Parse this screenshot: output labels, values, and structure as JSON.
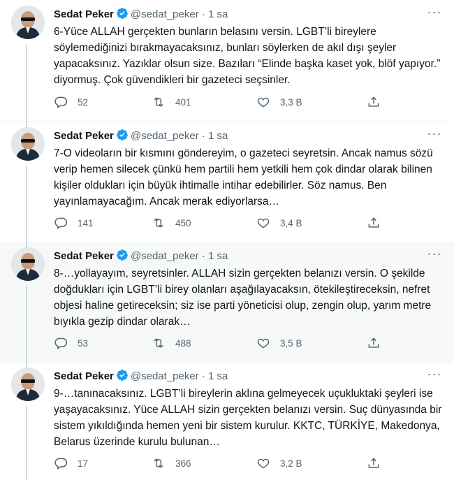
{
  "tweets": [
    {
      "author": "Sedat Peker",
      "handle": "@sedat_peker",
      "separator": "·",
      "time": "1 sa",
      "text": "6-Yüce ALLAH gerçekten bunların belasını versin. LGBT’li bireylere söylemediğinizi bırakmayacaksınız, bunları söylerken de akıl dışı şeyler yapacaksınız. Yazıklar olsun size. Bazıları “Elinde başka kaset yok, blöf yapıyor.” diyormuş. Çok güvendikleri bir gazeteci seçsinler.",
      "replies": "52",
      "retweets": "401",
      "likes": "3,3 B"
    },
    {
      "author": "Sedat Peker",
      "handle": "@sedat_peker",
      "separator": "·",
      "time": "1 sa",
      "text": "7-O videoların bir kısmını göndereyim, o gazeteci seyretsin. Ancak namus sözü verip hemen silecek çünkü hem partili hem yetkili hem çok dindar olarak bilinen kişiler oldukları için büyük ihtimalle intihar edebilirler. Söz namus. Ben yayınlamayacağım. Ancak merak ediyorlarsa…",
      "replies": "141",
      "retweets": "450",
      "likes": "3,4 B"
    },
    {
      "author": "Sedat Peker",
      "handle": "@sedat_peker",
      "separator": "·",
      "time": "1 sa",
      "text": "8-…yollayayım, seyretsinler. ALLAH sizin gerçekten belanızı versin. O şekilde doğdukları için LGBT’li birey olanları aşağılayacaksın, ötekileştireceksin, nefret objesi haline getireceksin; siz ise parti yöneticisi olup, zengin olup, yarım metre bıyıkla gezip dindar olarak…",
      "replies": "53",
      "retweets": "488",
      "likes": "3,5 B"
    },
    {
      "author": "Sedat Peker",
      "handle": "@sedat_peker",
      "separator": "·",
      "time": "1 sa",
      "text": "9-…tanınacaksınız. LGBT’li bireylerin aklına gelmeyecek uçukluktaki şeyleri ise yaşayacaksınız. Yüce ALLAH sizin gerçekten belanızı versin. Suç dünyasında bir sistem yıkıldığında hemen yeni bir sistem kurulur. KKTC, TÜRKİYE, Makedonya, Belarus üzerinde kurulu bulunan…",
      "replies": "17",
      "retweets": "366",
      "likes": "3,2 B"
    }
  ]
}
